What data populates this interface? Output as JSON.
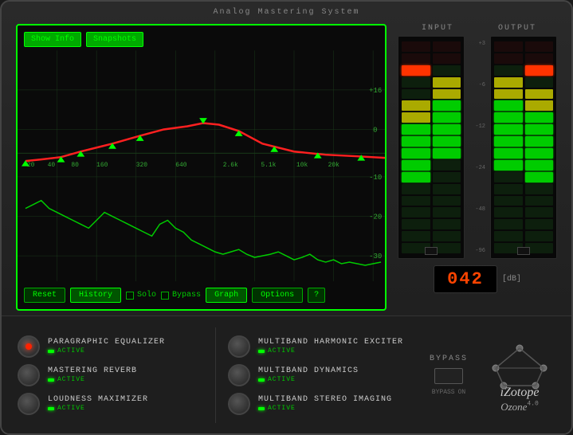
{
  "header": {
    "title": "Analog Mastering System"
  },
  "eq_panel": {
    "show_info_label": "Show Info",
    "snapshots_label": "Snapshots",
    "reset_label": "Reset",
    "history_label": "History",
    "solo_label": "Solo",
    "bypass_label": "Bypass",
    "graph_label": "Graph",
    "options_label": "Options",
    "help_label": "?"
  },
  "meters": {
    "input_label": "INPUT",
    "output_label": "OUTPUT",
    "db_value": "042",
    "db_unit": "[dB]",
    "scale": [
      "+3",
      "-6",
      "-12",
      "-24",
      "-48",
      "-96"
    ]
  },
  "modules": [
    {
      "name": "PARAGRAPHIC EQUALIZER",
      "status": "ACTIVE",
      "active": true
    },
    {
      "name": "MASTERING REVERB",
      "status": "ACTIVE",
      "active": false
    },
    {
      "name": "LOUDNESS MAXIMIZER",
      "status": "ACTIVE",
      "active": false
    },
    {
      "name": "MULTIBAND HARMONIC EXCITER",
      "status": "ACTIVE",
      "active": false
    },
    {
      "name": "MULTIBAND DYNAMICS",
      "status": "ACTIVE",
      "active": false
    },
    {
      "name": "MULTIBAND STEREO IMAGING",
      "status": "ACTIVE",
      "active": false
    }
  ],
  "bypass": {
    "label": "BYPASS",
    "bypass_label": "BYPASS",
    "on_label": "ON"
  },
  "logo": {
    "brand": "iZotope",
    "product": "Ozone",
    "superscript": "4.0"
  }
}
